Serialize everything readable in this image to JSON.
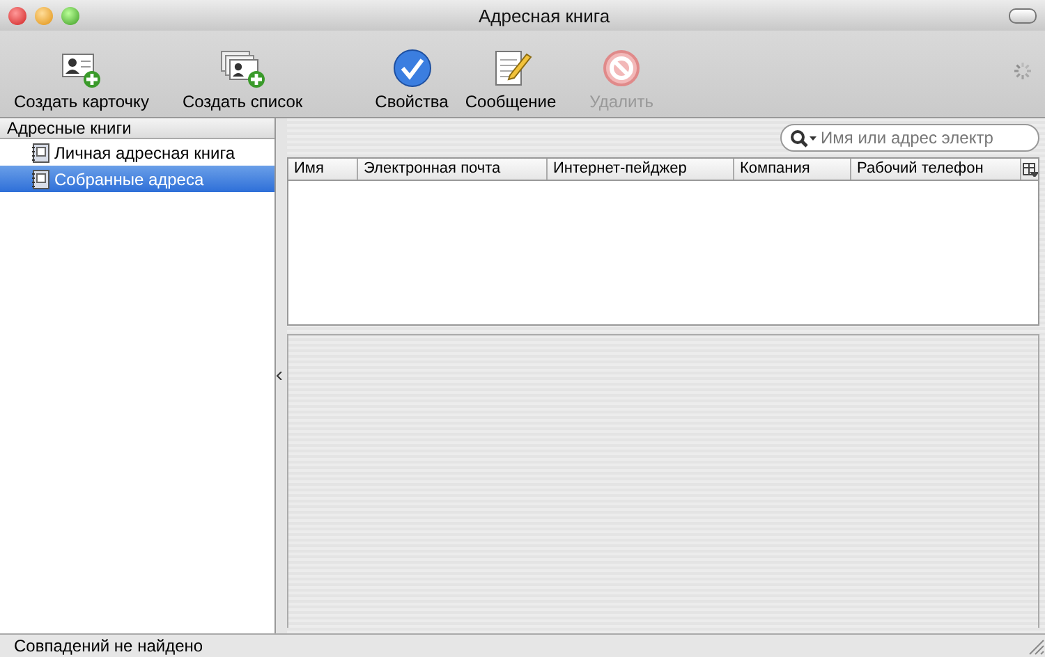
{
  "window": {
    "title": "Адресная книга"
  },
  "toolbar": [
    {
      "label": "Создать карточку",
      "kind": "card",
      "disabled": false
    },
    {
      "label": "Создать список",
      "kind": "list",
      "disabled": false
    },
    {
      "label": "Свойства",
      "kind": "properties",
      "disabled": false
    },
    {
      "label": "Сообщение",
      "kind": "message",
      "disabled": false
    },
    {
      "label": "Удалить",
      "kind": "delete",
      "disabled": true
    }
  ],
  "sidebar": {
    "header": "Адресные книги",
    "items": [
      {
        "label": "Личная адресная книга",
        "selected": false
      },
      {
        "label": "Собранные адреса",
        "selected": true
      }
    ]
  },
  "search": {
    "placeholder": "Имя или адрес электр"
  },
  "table": {
    "columns": [
      "Имя",
      "Электронная почта",
      "Интернет-пейджер",
      "Компания",
      "Рабочий телефон"
    ]
  },
  "status_bar": "Совпадений не найдено"
}
